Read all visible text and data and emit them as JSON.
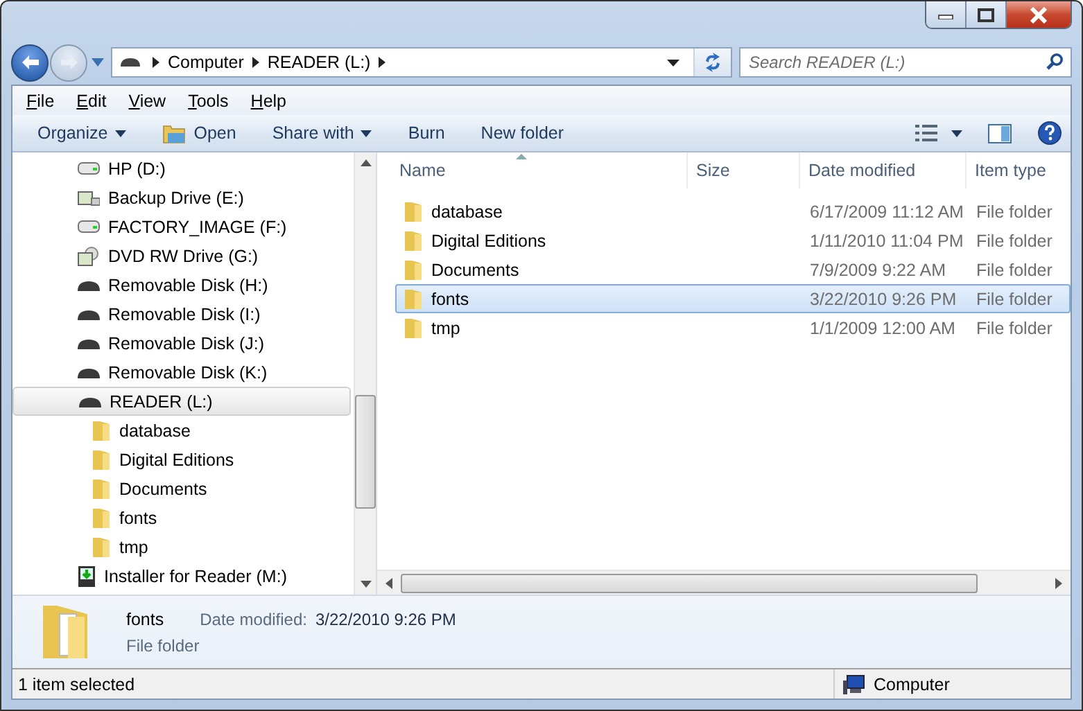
{
  "address": {
    "crumbs": [
      "Computer",
      "READER (L:)"
    ]
  },
  "search": {
    "placeholder": "Search READER (L:)"
  },
  "menu": [
    "File",
    "Edit",
    "View",
    "Tools",
    "Help"
  ],
  "toolbar": [
    {
      "label": "Organize",
      "kind": "dropdown"
    },
    {
      "label": "Open",
      "kind": "open"
    },
    {
      "label": "Share with",
      "kind": "dropdown"
    },
    {
      "label": "Burn",
      "kind": "plain"
    },
    {
      "label": "New folder",
      "kind": "plain"
    }
  ],
  "sidebar": [
    {
      "label": "HP (D:)",
      "kind": "hdd",
      "selected": false
    },
    {
      "label": "Backup Drive (E:)",
      "kind": "network",
      "selected": false
    },
    {
      "label": "FACTORY_IMAGE (F:)",
      "kind": "hdd",
      "selected": false
    },
    {
      "label": "DVD RW Drive (G:)",
      "kind": "dvd",
      "selected": false
    },
    {
      "label": "Removable Disk (H:)",
      "kind": "removable",
      "selected": false
    },
    {
      "label": "Removable Disk (I:)",
      "kind": "removable",
      "selected": false
    },
    {
      "label": "Removable Disk (J:)",
      "kind": "removable",
      "selected": false
    },
    {
      "label": "Removable Disk (K:)",
      "kind": "removable",
      "selected": false
    },
    {
      "label": "READER (L:)",
      "kind": "removable",
      "selected": true,
      "children": [
        {
          "label": "database",
          "kind": "folder",
          "selected": false
        },
        {
          "label": "Digital Editions",
          "kind": "folder",
          "selected": false
        },
        {
          "label": "Documents",
          "kind": "folder",
          "selected": false
        },
        {
          "label": "fonts",
          "kind": "folder",
          "selected": false
        },
        {
          "label": "tmp",
          "kind": "folder",
          "selected": false
        }
      ]
    },
    {
      "label": "Installer for Reader (M:)",
      "kind": "installer",
      "selected": false
    }
  ],
  "columns": [
    {
      "label": "Name",
      "sorted": true
    },
    {
      "label": "Size",
      "sorted": false
    },
    {
      "label": "Date modified",
      "sorted": false
    },
    {
      "label": "Item type",
      "sorted": false
    }
  ],
  "rows": [
    {
      "name": "database",
      "date": "6/17/2009 11:12 AM",
      "type": "File folder",
      "selected": false
    },
    {
      "name": "Digital Editions",
      "date": "1/11/2010 11:04 PM",
      "type": "File folder",
      "selected": false
    },
    {
      "name": "Documents",
      "date": "7/9/2009 9:22 AM",
      "type": "File folder",
      "selected": false
    },
    {
      "name": "fonts",
      "date": "3/22/2010 9:26 PM",
      "type": "File folder",
      "selected": true
    },
    {
      "name": "tmp",
      "date": "1/1/2009 12:00 AM",
      "type": "File folder",
      "selected": false
    }
  ],
  "details": {
    "name": "fonts",
    "date_label": "Date modified:",
    "date": "3/22/2010 9:26 PM",
    "type": "File folder"
  },
  "status_bar": {
    "text": "1 item selected",
    "zone": "Computer"
  }
}
